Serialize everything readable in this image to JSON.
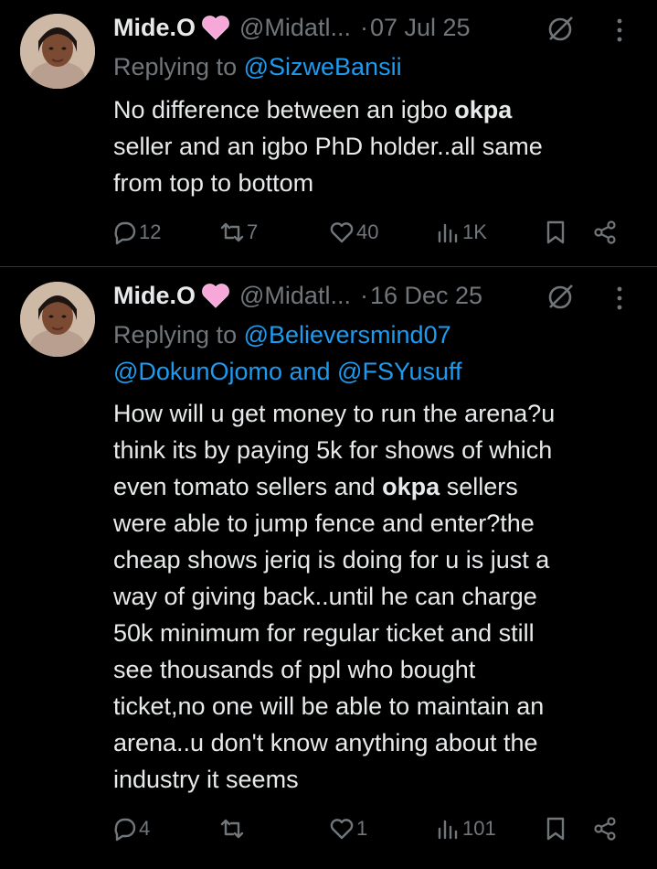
{
  "tweets": [
    {
      "name": "Mide.O",
      "handle": "@Midatl...",
      "dot": "·",
      "date": "07 Jul 25",
      "reply_prefix": "Replying to ",
      "reply_to_1": "@SizweBansii",
      "text": {
        "l1a": "No difference between an igbo ",
        "l1b": "okpa",
        "l2": "seller and an igbo PhD holder..all same",
        "l3": "from top to bottom"
      },
      "actions": {
        "replies": "12",
        "reposts": "7",
        "likes": "40",
        "views": "1K"
      }
    },
    {
      "name": "Mide.O",
      "handle": "@Midatl...",
      "dot": "·",
      "date": "16 Dec 25",
      "reply_prefix": "Replying to ",
      "reply_to_1": "@Believersmind07",
      "reply_to_2": "@DokunOjomo",
      "reply_and": " and ",
      "reply_to_3": "@FSYusuff",
      "text": {
        "l1": "How will u get money to run the arena?u",
        "l2": "think its by paying 5k for shows of which",
        "l3a": "even tomato sellers and ",
        "l3b": "okpa",
        "l3c": " sellers",
        "l4": "were able to jump fence and enter?the",
        "l5": "cheap shows jeriq is doing for u is just a",
        "l6": "way of giving back..until he can charge",
        "l7": "50k minimum for regular ticket and still",
        "l8": "see thousands of ppl who bought",
        "l9": "ticket,no one will be able to maintain an",
        "l10": "arena..u don't know anything about the",
        "l11": "industry it seems"
      },
      "actions": {
        "replies": "4",
        "reposts": "",
        "likes": "1",
        "views": "101"
      }
    }
  ],
  "icons": {
    "heart_emoji_color": "#f7a8d8",
    "muted": "muted-icon",
    "more": "more-icon"
  },
  "colors": {
    "link": "#1d9bf0",
    "muted_text": "#71767b",
    "text": "#e7e9ea",
    "bg": "#000000"
  }
}
